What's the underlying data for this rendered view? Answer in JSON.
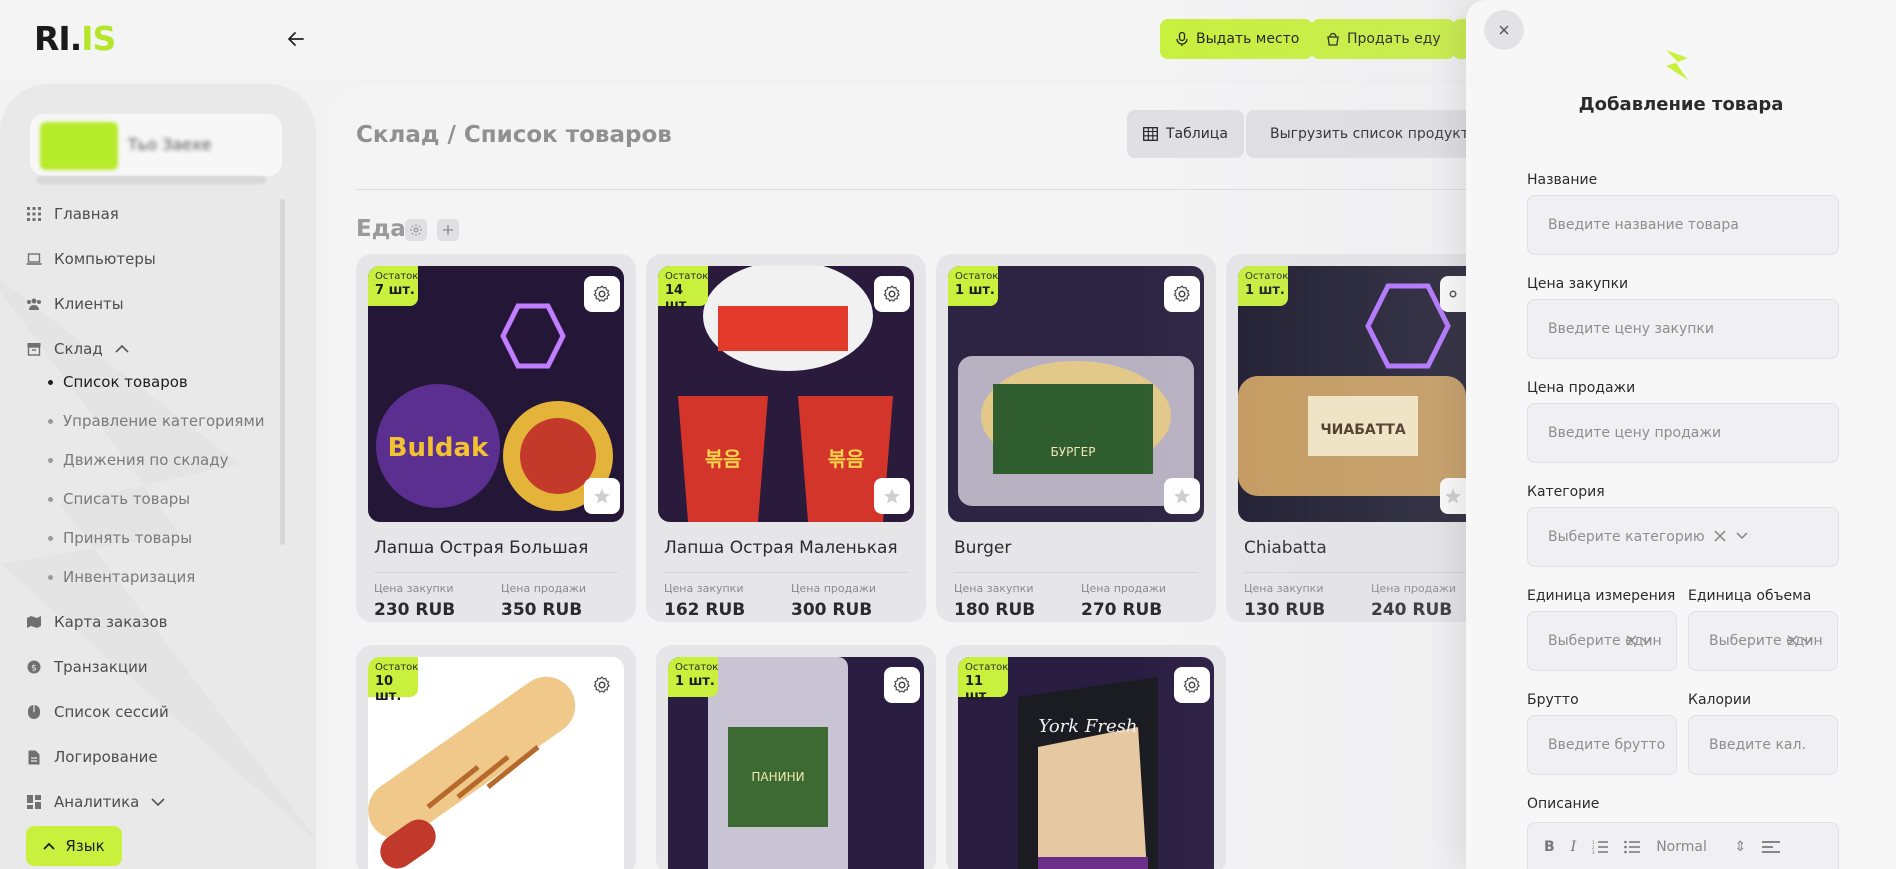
{
  "app": {
    "logo_text_dark": "RI.",
    "logo_text_accent": "IS",
    "accent_color": "#c8f03c"
  },
  "header": {
    "buttons": [
      {
        "label": "Выдать место",
        "icon": "microphone-icon"
      },
      {
        "label": "Продать еду",
        "icon": "food-icon"
      }
    ]
  },
  "sidebar": {
    "club_name": "Тьо Заехе",
    "nav": [
      {
        "label": "Главная",
        "icon": "grid-icon"
      },
      {
        "label": "Компьютеры",
        "icon": "laptop-icon"
      },
      {
        "label": "Клиенты",
        "icon": "users-icon"
      },
      {
        "label": "Склад",
        "icon": "archive-icon",
        "expanded": true
      }
    ],
    "sub_items": [
      {
        "label": "Список товаров",
        "active": true
      },
      {
        "label": "Управление категориями"
      },
      {
        "label": "Движения по складу"
      },
      {
        "label": "Списать товары"
      },
      {
        "label": "Принять товары"
      },
      {
        "label": "Инвентаризация"
      }
    ],
    "nav_bottom": [
      {
        "label": "Карта заказов",
        "icon": "map-icon"
      },
      {
        "label": "Транзакции",
        "icon": "coin-icon"
      },
      {
        "label": "Список сессий",
        "icon": "clock-icon"
      },
      {
        "label": "Логирование",
        "icon": "document-icon"
      },
      {
        "label": "Аналитика",
        "icon": "chart-icon",
        "expandable": true
      }
    ],
    "language_button": "Язык"
  },
  "main": {
    "breadcrumb": "Склад / Список товаров",
    "table_button": "Таблица",
    "export_button": "Выгрузить список продуктов",
    "category_title": "Еда",
    "stock_label": "Остаток",
    "purchase_label": "Цена закупки",
    "sale_label": "Цена продажи",
    "products": [
      {
        "name": "Лапша Острая Большая",
        "stock": "7 шт.",
        "purchase": "230 RUB",
        "sale": "350 RUB"
      },
      {
        "name": "Лапша Острая Маленькая",
        "stock": "14 шт.",
        "purchase": "162 RUB",
        "sale": "300 RUB"
      },
      {
        "name": "Burger",
        "stock": "1 шт.",
        "purchase": "180 RUB",
        "sale": "270 RUB"
      },
      {
        "name": "Chiabatta",
        "stock": "1 шт.",
        "purchase": "130 RUB",
        "sale": "240 RUB"
      },
      {
        "name": "",
        "stock": "10 шт.",
        "purchase": "",
        "sale": ""
      },
      {
        "name": "",
        "stock": "1 шт.",
        "purchase": "",
        "sale": ""
      },
      {
        "name": "",
        "stock": "11 шт.",
        "purchase": "",
        "sale": ""
      }
    ]
  },
  "drawer": {
    "title": "Добавление товара",
    "fields": {
      "name": {
        "label": "Название",
        "placeholder": "Введите название товара"
      },
      "purchase_price": {
        "label": "Цена закупки",
        "placeholder": "Введите цену закупки"
      },
      "sale_price": {
        "label": "Цена продажи",
        "placeholder": "Введите цену продажи"
      },
      "category": {
        "label": "Категория",
        "placeholder": "Выберите категорию"
      },
      "unit": {
        "label": "Единица измерения",
        "placeholder": "Выберите един"
      },
      "volume_unit": {
        "label": "Единица объема",
        "placeholder": "Выберите един"
      },
      "gross": {
        "label": "Брутто",
        "placeholder": "Введите брутто"
      },
      "calories": {
        "label": "Калории",
        "placeholder": "Введите кал."
      },
      "description": {
        "label": "Описание"
      }
    },
    "editor": {
      "bold": "B",
      "italic": "I",
      "style": "Normal"
    }
  }
}
